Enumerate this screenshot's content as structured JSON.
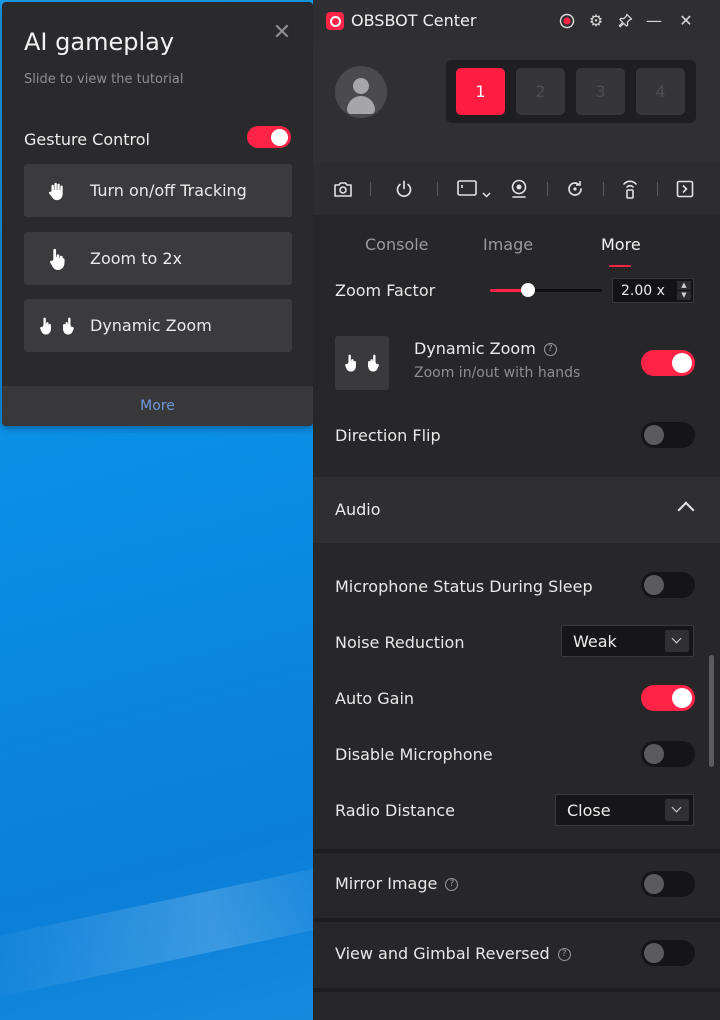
{
  "tutorial": {
    "title": "AI gameplay",
    "subtitle": "Slide to view the tutorial",
    "gesture_label": "Gesture Control",
    "gesture_on": true,
    "cards": [
      {
        "label": "Turn on/off Tracking",
        "icon": "open-hand-icon"
      },
      {
        "label": "Zoom to 2x",
        "icon": "pointing-hand-icon"
      },
      {
        "label": "Dynamic Zoom",
        "icon": "two-hands-icon"
      }
    ],
    "footer": "More"
  },
  "app": {
    "title": "OBSBOT Center",
    "slots": [
      "1",
      "2",
      "3",
      "4"
    ],
    "active_slot": 0,
    "tabs": [
      "Console",
      "Image",
      "More"
    ],
    "active_tab": 2
  },
  "more": {
    "zoom_factor": {
      "label": "Zoom Factor",
      "value": "2.00 x",
      "slider_fraction": 0.34
    },
    "dynamic_zoom": {
      "title": "Dynamic Zoom",
      "subtitle": "Zoom in/out with hands",
      "on": true
    },
    "direction_flip": {
      "label": "Direction Flip",
      "on": false
    },
    "audio": {
      "header": "Audio",
      "mic_sleep": {
        "label": "Microphone Status During Sleep",
        "on": false
      },
      "noise_reduction": {
        "label": "Noise Reduction",
        "value": "Weak"
      },
      "auto_gain": {
        "label": "Auto Gain",
        "on": true
      },
      "disable_mic": {
        "label": "Disable Microphone",
        "on": false
      },
      "radio_distance": {
        "label": "Radio Distance",
        "value": "Close"
      }
    },
    "mirror_image": {
      "label": "Mirror Image",
      "on": false
    },
    "view_gimbal": {
      "label": "View and Gimbal Reversed",
      "on": false
    }
  },
  "colors": {
    "accent": "#ff2447",
    "panel": "#27272a",
    "desktop": "#0a8fe6"
  }
}
